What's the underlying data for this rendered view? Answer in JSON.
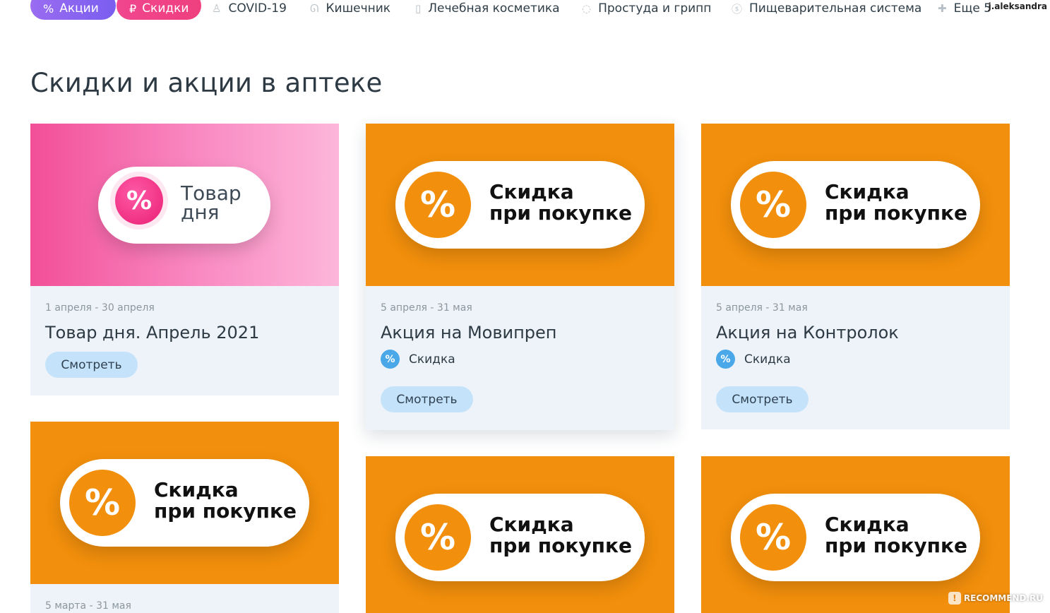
{
  "nav": {
    "pills": [
      {
        "label": "Акции",
        "icon": "%"
      },
      {
        "label": "Скидки",
        "icon": "₽"
      }
    ],
    "items": [
      {
        "label": "COVID-19",
        "icon": "♙"
      },
      {
        "label": "Кишечник",
        "icon": "ᘏ"
      },
      {
        "label": "Лечебная косметика",
        "icon": "▯"
      },
      {
        "label": "Простуда и грипп",
        "icon": "◌"
      },
      {
        "label": "Пищеварительная система",
        "icon": "ⓢ"
      },
      {
        "label": "Еще 5",
        "icon": "✚"
      }
    ],
    "username": "j.aleksandra"
  },
  "page": {
    "title": "Скидки и акции в аптеке"
  },
  "cards": [
    {
      "date": "1 апреля - 30 апреля",
      "title": "Товар дня. Апрель 2021",
      "banner_line1": "Товар",
      "banner_line2": "дня",
      "button": "Смотреть"
    },
    {
      "date": "5 апреля - 31 мая",
      "title": "Акция на Мовипреп",
      "banner_line1": "Скидка",
      "banner_line2": "при покупке",
      "tag": "Скидка",
      "button": "Смотреть"
    },
    {
      "date": "5 апреля - 31 мая",
      "title": "Акция на Контролок",
      "banner_line1": "Скидка",
      "banner_line2": "при покупке",
      "tag": "Скидка",
      "button": "Смотреть"
    },
    {
      "date": "5 марта - 31 мая",
      "banner_line1": "Скидка",
      "banner_line2": "при покупке"
    },
    {
      "banner_line1": "Скидка",
      "banner_line2": "при покупке"
    },
    {
      "banner_line1": "Скидка",
      "banner_line2": "при покупке"
    }
  ],
  "colors": {
    "orange": "#f28f0c",
    "pink": "#f24f98",
    "button": "#c4e3fa",
    "card_bg": "#eef3fa",
    "tag_icon": "#4aa7e8"
  },
  "watermark": "RECOMMEND.RU"
}
